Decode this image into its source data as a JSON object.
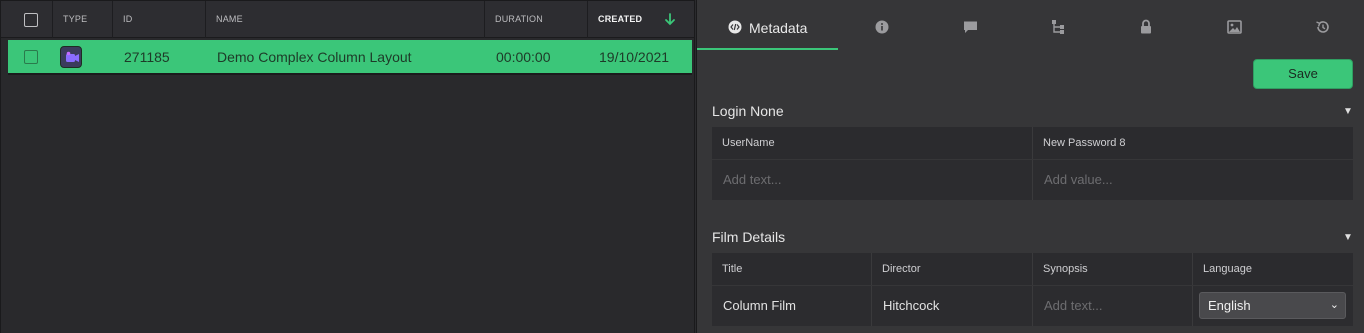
{
  "table": {
    "columns": {
      "type": "TYPE",
      "id": "ID",
      "name": "NAME",
      "duration": "DURATION",
      "created": "CREATED"
    },
    "rows": [
      {
        "id": "271185",
        "name": "Demo Complex Column Layout",
        "duration": "00:00:00",
        "created": "19/10/2021",
        "type_icon": "video-icon"
      }
    ],
    "sort_icon": "arrow-down-icon"
  },
  "panel": {
    "tabs": [
      {
        "label": "Metadata",
        "icon": "code-icon",
        "active": true
      },
      {
        "label": "",
        "icon": "info-icon"
      },
      {
        "label": "",
        "icon": "comment-icon"
      },
      {
        "label": "",
        "icon": "hierarchy-icon"
      },
      {
        "label": "",
        "icon": "lock-icon"
      },
      {
        "label": "",
        "icon": "image-icon"
      },
      {
        "label": "",
        "icon": "history-icon"
      }
    ],
    "save_label": "Save",
    "sections": {
      "login": {
        "title": "Login None",
        "headers": [
          "UserName",
          "New Password 8"
        ],
        "placeholders": [
          "Add text...",
          "Add value..."
        ]
      },
      "film": {
        "title": "Film Details",
        "headers": [
          "Title",
          "Director",
          "Synopsis",
          "Language"
        ],
        "values": {
          "title": "Column Film",
          "director": "Hitchcock",
          "synopsis_placeholder": "Add text...",
          "language": "English"
        }
      }
    }
  },
  "colors": {
    "accent": "#3bc679",
    "panel_bg": "#363638",
    "table_bg": "#29292c"
  }
}
